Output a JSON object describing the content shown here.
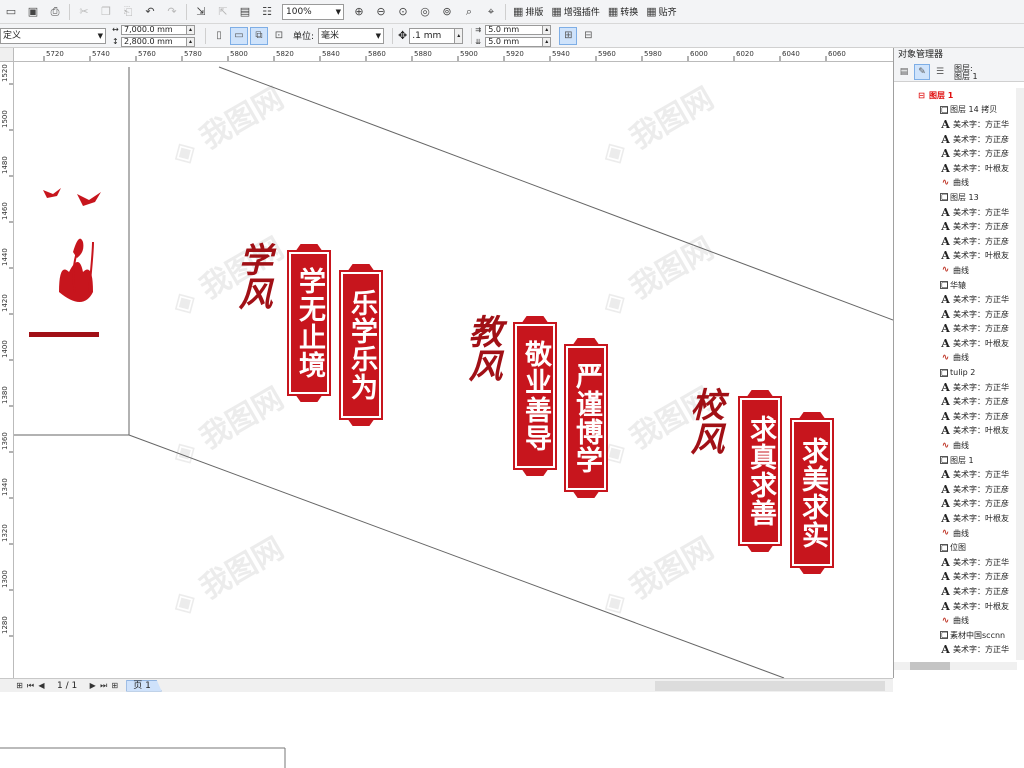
{
  "toolbar1": {
    "zoom": "100%",
    "layout_label": "排版",
    "plugin_label": "增强插件",
    "convert_label": "转换",
    "snap_label": "贴齐"
  },
  "toolbar2": {
    "preset": "定义",
    "width": "7,000.0 mm",
    "height": "2,800.0 mm",
    "unit_label": "单位:",
    "unit": "毫米",
    "nudge": ".1 mm",
    "dup_x": "5.0 mm",
    "dup_y": "5.0 mm"
  },
  "ruler": {
    "h_ticks": [
      "5720",
      "5740",
      "5760",
      "5780",
      "5800",
      "5820",
      "5840",
      "5860",
      "5880",
      "5900",
      "5920",
      "5940",
      "5960",
      "5980",
      "6000",
      "6020",
      "6040",
      "6060"
    ],
    "v_ticks": [
      "1520",
      "1500",
      "1480",
      "1460",
      "1440",
      "1420",
      "1400",
      "1380",
      "1360",
      "1340",
      "1320",
      "1300",
      "1280"
    ],
    "h_unit": "毫米"
  },
  "canvas": {
    "groups": [
      {
        "calligraphy": "学风",
        "banners": [
          "学无止境",
          "乐学乐为"
        ]
      },
      {
        "calligraphy": "教风",
        "banners": [
          "敬业善导",
          "严谨博学"
        ]
      },
      {
        "calligraphy": "校风",
        "banners": [
          "求真求善",
          "求美求实"
        ]
      }
    ],
    "accent_color": "#c7151d",
    "calligraphy_color": "#a11016"
  },
  "pagebar": {
    "page_count": "1 / 1",
    "page_tab": "页 1"
  },
  "object_manager": {
    "title": "对象管理器",
    "layer_head": [
      "图层:",
      "图层 1"
    ],
    "tree": [
      {
        "type": "layer",
        "label": "图层 1"
      },
      {
        "type": "group",
        "label": "图层 14 拷贝"
      },
      {
        "type": "art",
        "label": "美术字：方正华"
      },
      {
        "type": "art",
        "label": "美术字：方正彦"
      },
      {
        "type": "art",
        "label": "美术字：方正彦"
      },
      {
        "type": "art",
        "label": "美术字：叶根友"
      },
      {
        "type": "curve",
        "label": "曲线"
      },
      {
        "type": "group",
        "label": "图层 13"
      },
      {
        "type": "art",
        "label": "美术字：方正华"
      },
      {
        "type": "art",
        "label": "美术字：方正彦"
      },
      {
        "type": "art",
        "label": "美术字：方正彦"
      },
      {
        "type": "art",
        "label": "美术字：叶根友"
      },
      {
        "type": "curve",
        "label": "曲线"
      },
      {
        "type": "group",
        "label": "华辕"
      },
      {
        "type": "art",
        "label": "美术字：方正华"
      },
      {
        "type": "art",
        "label": "美术字：方正彦"
      },
      {
        "type": "art",
        "label": "美术字：方正彦"
      },
      {
        "type": "art",
        "label": "美术字：叶根友"
      },
      {
        "type": "curve",
        "label": "曲线"
      },
      {
        "type": "group",
        "label": "tulip 2"
      },
      {
        "type": "art",
        "label": "美术字：方正华"
      },
      {
        "type": "art",
        "label": "美术字：方正彦"
      },
      {
        "type": "art",
        "label": "美术字：方正彦"
      },
      {
        "type": "art",
        "label": "美术字：叶根友"
      },
      {
        "type": "curve",
        "label": "曲线"
      },
      {
        "type": "group",
        "label": "图层 1"
      },
      {
        "type": "art",
        "label": "美术字：方正华"
      },
      {
        "type": "art",
        "label": "美术字：方正彦"
      },
      {
        "type": "art",
        "label": "美术字：方正彦"
      },
      {
        "type": "art",
        "label": "美术字：叶根友"
      },
      {
        "type": "curve",
        "label": "曲线"
      },
      {
        "type": "group",
        "label": "位图"
      },
      {
        "type": "art",
        "label": "美术字：方正华"
      },
      {
        "type": "art",
        "label": "美术字：方正彦"
      },
      {
        "type": "art",
        "label": "美术字：方正彦"
      },
      {
        "type": "art",
        "label": "美术字：叶根友"
      },
      {
        "type": "curve",
        "label": "曲线"
      },
      {
        "type": "group",
        "label": "素材中国sccnn"
      },
      {
        "type": "art",
        "label": "美术字：方正华"
      }
    ]
  }
}
